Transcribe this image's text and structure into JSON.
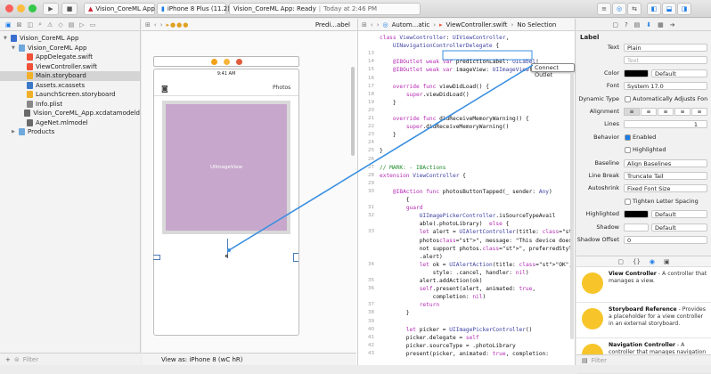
{
  "toolbar": {
    "scheme_app": "Vision_CoreML App",
    "device": "iPhone 8 Plus (11.2)",
    "status_main": "Vision_CoreML App: Ready",
    "status_sep": " | ",
    "status_time": "Today at 2:46 PM"
  },
  "navigator": {
    "items": [
      {
        "label": "Vision_CoreML App",
        "level": 0,
        "kind": "project",
        "expanded": true
      },
      {
        "label": "Vision_CoreML App",
        "level": 1,
        "kind": "folder",
        "expanded": true
      },
      {
        "label": "AppDelegate.swift",
        "level": 2,
        "kind": "swift"
      },
      {
        "label": "ViewController.swift",
        "level": 2,
        "kind": "swift"
      },
      {
        "label": "Main.storyboard",
        "level": 2,
        "kind": "storyboard",
        "selected": true
      },
      {
        "label": "Assets.xcassets",
        "level": 2,
        "kind": "assets"
      },
      {
        "label": "LaunchScreen.storyboard",
        "level": 2,
        "kind": "storyboard"
      },
      {
        "label": "Info.plist",
        "level": 2,
        "kind": "plist"
      },
      {
        "label": "Vision_CoreML_App.xcdatamodeld",
        "level": 2,
        "kind": "model"
      },
      {
        "label": "AgeNet.mlmodel",
        "level": 2,
        "kind": "mlmodel"
      },
      {
        "label": "Products",
        "level": 1,
        "kind": "folder",
        "expanded": false
      }
    ],
    "filter_placeholder": "Filter"
  },
  "ib": {
    "jump_label": "Predi...abel",
    "nav_title": "Photos",
    "status_time": "9:41 AM",
    "image_view_label": "UIImageView",
    "view_as": "View as: iPhone 8 (wC hR)"
  },
  "editor": {
    "jump_auto": "Autom...atic",
    "jump_file": "ViewController.swift",
    "jump_selection": "No Selection",
    "connect_tooltip": "Connect Outlet",
    "lines": [
      {
        "n": "",
        "t": "class ViewController: UIViewController,"
      },
      {
        "n": "",
        "t": "    UINavigationControllerDelegate {"
      },
      {
        "n": "13",
        "t": ""
      },
      {
        "n": "14",
        "t": "    @IBOutlet weak var predictionLabel: UILabel!"
      },
      {
        "n": "15",
        "t": "    @IBOutlet weak var imageView: UIImageView!"
      },
      {
        "n": "16",
        "t": ""
      },
      {
        "n": "17",
        "t": "    override func viewDidLoad() {"
      },
      {
        "n": "18",
        "t": "        super.viewDidLoad()"
      },
      {
        "n": "19",
        "t": "    }"
      },
      {
        "n": "20",
        "t": ""
      },
      {
        "n": "21",
        "t": "    override func didReceiveMemoryWarning() {"
      },
      {
        "n": "22",
        "t": "        super.didReceiveMemoryWarning()"
      },
      {
        "n": "23",
        "t": "    }"
      },
      {
        "n": "24",
        "t": ""
      },
      {
        "n": "25",
        "t": "}"
      },
      {
        "n": "26",
        "t": ""
      },
      {
        "n": "27",
        "t": "// MARK: - IBActions"
      },
      {
        "n": "28",
        "t": "extension ViewController {"
      },
      {
        "n": "29",
        "t": ""
      },
      {
        "n": "30",
        "t": "    @IBAction func photosButtonTapped(_ sender: Any)"
      },
      {
        "n": "",
        "t": "        {"
      },
      {
        "n": "31",
        "t": "        guard"
      },
      {
        "n": "32",
        "t": "            UIImagePickerController.isSourceTypeAvail"
      },
      {
        "n": "",
        "t": "            able(.photoLibrary)  else {"
      },
      {
        "n": "33",
        "t": "            let alert = UIAlertController(title: \"No"
      },
      {
        "n": "",
        "t": "            photos\", message: \"This device does"
      },
      {
        "n": "",
        "t": "            not support photos.\", preferredStyle:"
      },
      {
        "n": "",
        "t": "            .alert)"
      },
      {
        "n": "34",
        "t": "            let ok = UIAlertAction(title: \"OK\","
      },
      {
        "n": "",
        "t": "                style: .cancel, handler: nil)"
      },
      {
        "n": "35",
        "t": "            alert.addAction(ok)"
      },
      {
        "n": "36",
        "t": "            self.present(alert, animated: true,"
      },
      {
        "n": "",
        "t": "                completion: nil)"
      },
      {
        "n": "37",
        "t": "            return"
      },
      {
        "n": "38",
        "t": "        }"
      },
      {
        "n": "39",
        "t": ""
      },
      {
        "n": "40",
        "t": "        let picker = UIImagePickerController()"
      },
      {
        "n": "41",
        "t": "        picker.delegate = self"
      },
      {
        "n": "42",
        "t": "        picker.sourceType = .photoLibrary"
      },
      {
        "n": "43",
        "t": "        present(picker, animated: true, completion:"
      }
    ]
  },
  "inspector": {
    "section": "Label",
    "rows": [
      {
        "label": "Text",
        "value": "Plain"
      },
      {
        "label": "",
        "value": "Text"
      },
      {
        "label": "Color",
        "value": "Default"
      },
      {
        "label": "Font",
        "value": "System 17.0"
      },
      {
        "label": "Dynamic Type",
        "value": "Automatically Adjusts Font"
      },
      {
        "label": "Alignment",
        "value": ""
      },
      {
        "label": "Lines",
        "value": "1"
      },
      {
        "label": "Behavior",
        "value": "Enabled"
      },
      {
        "label": "",
        "value": "Highlighted"
      },
      {
        "label": "Baseline",
        "value": "Align Baselines"
      },
      {
        "label": "Line Break",
        "value": "Truncate Tail"
      },
      {
        "label": "Autoshrink",
        "value": "Fixed Font Size"
      },
      {
        "label": "",
        "value": "Tighten Letter Spacing"
      },
      {
        "label": "Highlighted",
        "value": "Default"
      },
      {
        "label": "Shadow",
        "value": "Default"
      },
      {
        "label": "Shadow Offset",
        "value": "0"
      }
    ],
    "library": [
      {
        "title": "View Controller",
        "desc": " - A controller that manages a view."
      },
      {
        "title": "Storyboard Reference",
        "desc": " - Provides a placeholder for a view controller in an external storyboard."
      },
      {
        "title": "Navigation Controller",
        "desc": " - A controller that manages navigation through a hierarchy of views."
      }
    ],
    "filter_placeholder": "Filter"
  },
  "colors": {
    "accent": "#1a7ce6",
    "image_view_fill": "#c7a8cc",
    "connect_line": "#3b8fe0",
    "library_icon": "#f7c52a"
  }
}
